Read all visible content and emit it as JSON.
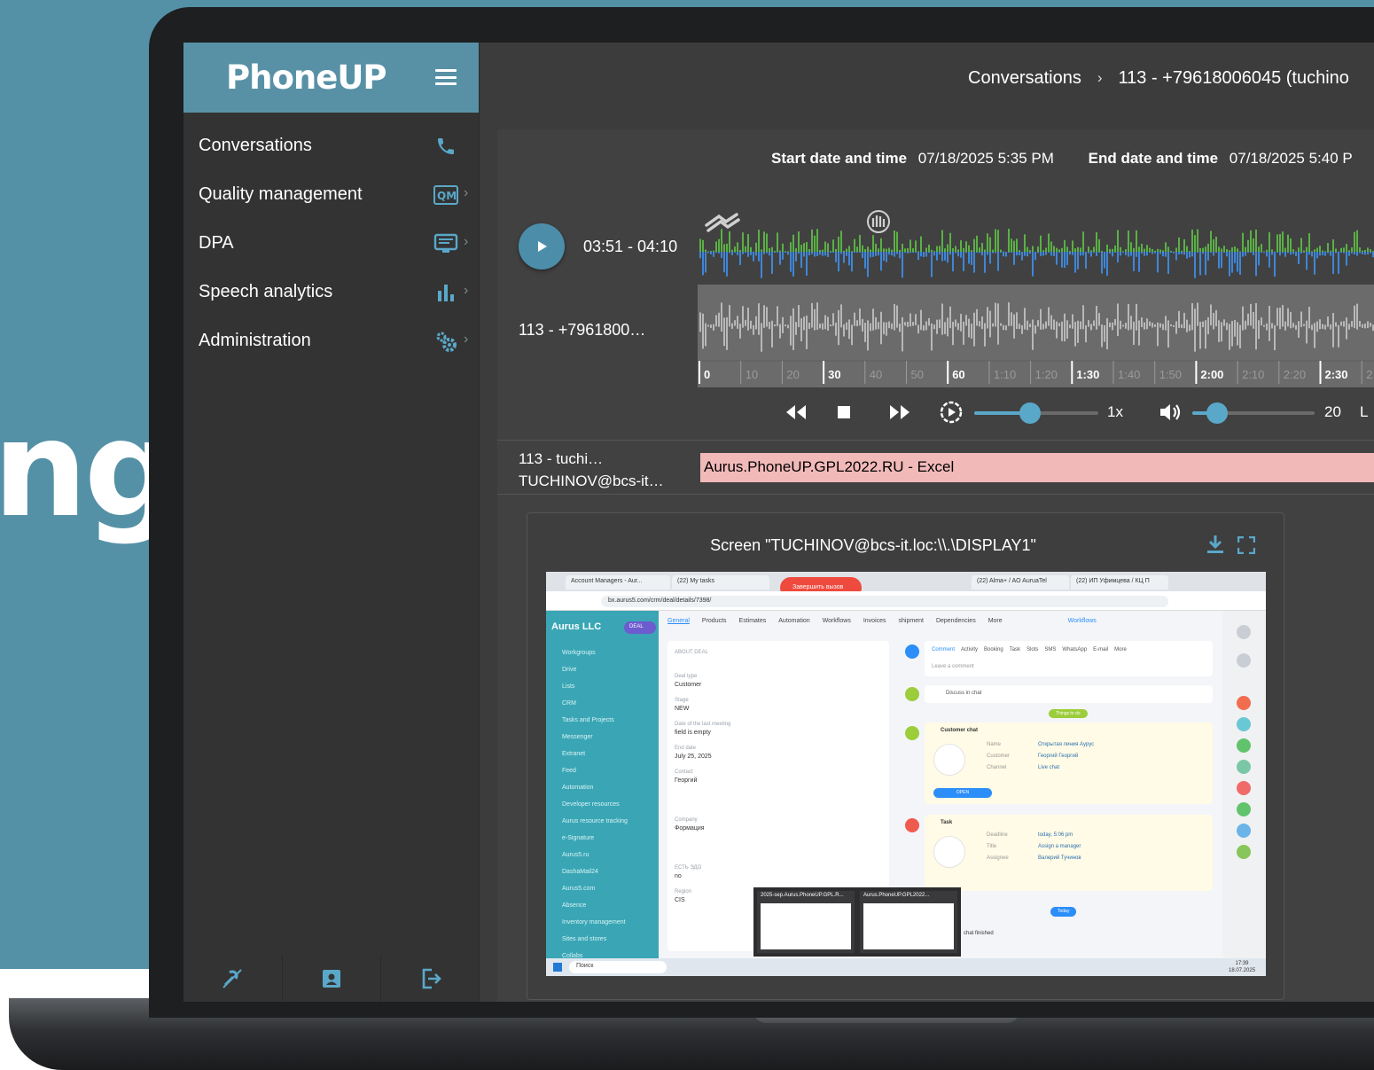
{
  "background": {
    "partial_word": "ng"
  },
  "brand": {
    "name": "PhoneUP"
  },
  "sidebar": {
    "items": [
      {
        "label": "Conversations",
        "icon": "phone-icon"
      },
      {
        "label": "Quality management",
        "icon": "qm-icon"
      },
      {
        "label": "DPA",
        "icon": "monitor-icon"
      },
      {
        "label": "Speech analytics",
        "icon": "bar-chart-icon"
      },
      {
        "label": "Administration",
        "icon": "gears-icon"
      }
    ],
    "bottom_icons": [
      "disabled-tools-icon",
      "contact-card-icon",
      "logout-icon"
    ]
  },
  "breadcrumb": {
    "section": "Conversations",
    "current": "113 - +79618006045 (tuchino"
  },
  "call": {
    "start_label": "Start date and time",
    "start_value": "07/18/2025 5:35 PM",
    "end_label": "End date and time",
    "end_value": "07/18/2025 5:40 P",
    "segment": "03:51 - 04:10",
    "channel_label": "113  -  +7961800…",
    "user_label_line1": "113  -  tuchi…",
    "user_label_line2": "TUCHINOV@bcs-it…",
    "active_window": "Aurus.PhoneUP.GPL2022.RU - Excel"
  },
  "timeline": {
    "ticks": [
      "0",
      "10",
      "20",
      "30",
      "40",
      "50",
      "60",
      "1:10",
      "1:20",
      "1:30",
      "1:40",
      "1:50",
      "2:00",
      "2:10",
      "2:20",
      "2:30",
      "2"
    ]
  },
  "player": {
    "speed": "1x",
    "speed_level": 0.45,
    "volume": "20",
    "volume_level": 0.2,
    "layout_letter": "L"
  },
  "screen": {
    "title": "Screen \"TUCHINOV@bcs-it.loc:\\\\.\\DISPLAY1\"",
    "shot": {
      "tabs": [
        "Account Managers - Aur...",
        "(22) My tasks",
        "(22) Alma+ / AO AuruaTel",
        "(22) ИП Уфимцева / КЦ П"
      ],
      "recording_button": "Завершить вызов",
      "url": "bx.aurus5.com/crm/deal/details/7398/",
      "company": "Aurus LLC",
      "deal_badge": "DEAL",
      "side_links": [
        "Workgroups",
        "Drive",
        "Lists",
        "CRM",
        "Tasks and Projects",
        "Messenger",
        "Extranet",
        "Feed",
        "Automation",
        "Developer resources",
        "Aurus resource tracking",
        "e-Signature",
        "Aurus5.ru",
        "DashaMail24",
        "Aurus5.com",
        "Absence",
        "Inventory management",
        "Sites and stores",
        "Collabs"
      ],
      "nav": [
        "General",
        "Products",
        "Estimates",
        "Automation",
        "Workflows",
        "Invoices",
        "shipment",
        "Dependencies",
        "More",
        "Workflows"
      ],
      "deal_fields": [
        {
          "label": "ABOUT DEAL",
          "value": ""
        },
        {
          "label": "Deal type",
          "value": "Customer"
        },
        {
          "label": "Stage",
          "value": "NEW"
        },
        {
          "label": "Date of the last meeting",
          "value": "field is empty"
        },
        {
          "label": "End date",
          "value": "July 25, 2025"
        },
        {
          "label": "Contact",
          "value": "Георгий"
        },
        {
          "label": "Company",
          "value": "Формация"
        },
        {
          "label": "ЕСТЬ ЭДО",
          "value": "no"
        },
        {
          "label": "Region",
          "value": "CIS"
        }
      ],
      "feed_tabs": [
        "Comment",
        "Activity",
        "Booking",
        "Task",
        "Slots",
        "SMS",
        "WhatsApp",
        "E-mail",
        "More"
      ],
      "feed_placeholder": "Leave a comment",
      "discuss": "Discuss in chat",
      "things_to_do": "Things to do",
      "customer_chat": "Customer chat",
      "chat_rows": [
        [
          "Name",
          "Открытая линия Аурус"
        ],
        [
          "Customer",
          "Георгий Георгий"
        ],
        [
          "Channel",
          "Live chat"
        ]
      ],
      "open_btn": "OPEN",
      "task": "Task",
      "task_rows": [
        [
          "Deadline",
          "today, 5:06 pm"
        ],
        [
          "Title",
          "Assign a manager"
        ],
        [
          "Assignee",
          "Валерий Тучинов"
        ]
      ],
      "today": "Today",
      "chat_finished": "chat finished",
      "thumbs": [
        "2025-sep.Aurus.PhoneUP.GPL.R...",
        "Aurus.PhoneUP.GPL2022..."
      ],
      "taskbar_search": "Поиск",
      "clock_time": "17:39",
      "clock_date": "18.07.2025"
    }
  },
  "colors": {
    "accent": "#5591a6",
    "icon_blue": "#5aa8c9",
    "wave_green": "#5bb045",
    "wave_blue": "#3f86d8",
    "window_bar": "#f2b9b9"
  }
}
